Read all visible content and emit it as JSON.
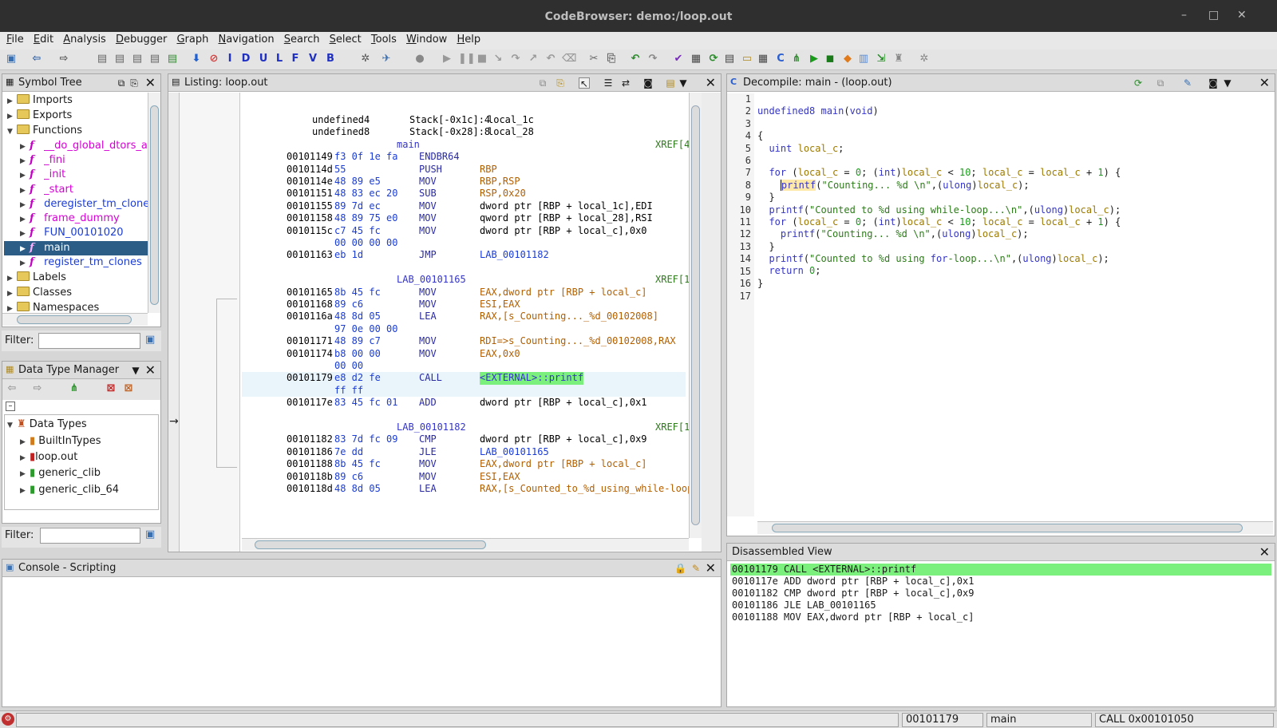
{
  "window": {
    "title": "CodeBrowser: demo:/loop.out",
    "minimize": "–",
    "maximize": "□",
    "close": "✕"
  },
  "menu": [
    "File",
    "Edit",
    "Analysis",
    "Debugger",
    "Graph",
    "Navigation",
    "Search",
    "Select",
    "Tools",
    "Window",
    "Help"
  ],
  "symbol_tree": {
    "title": "Symbol Tree",
    "roots": [
      "Imports",
      "Exports",
      "Functions"
    ],
    "functions": [
      "__do_global_dtors_a",
      "_fini",
      "_init",
      "_start",
      "deregister_tm_clone",
      "frame_dummy",
      "FUN_00101020",
      "main",
      "register_tm_clones"
    ],
    "more_roots": [
      "Labels",
      "Classes",
      "Namespaces"
    ],
    "filter_label": "Filter:"
  },
  "dtm": {
    "title": "Data Type Manager",
    "root": "Data Types",
    "items": [
      "BuiltInTypes",
      "loop.out",
      "generic_clib",
      "generic_clib_64"
    ],
    "filter_label": "Filter:"
  },
  "listing": {
    "title": "Listing:  loop.out",
    "lines": [
      {
        "kind": "stack",
        "type": "undefined4",
        "loc": "Stack[-0x1c]:4",
        "name": "local_1c"
      },
      {
        "kind": "stack",
        "type": "undefined8",
        "loc": "Stack[-0x28]:8",
        "name": "local_28"
      },
      {
        "kind": "label",
        "name": "main",
        "xref": "XREF[4"
      },
      {
        "kind": "ins",
        "addr": "00101149",
        "bytes": "f3 0f 1e fa",
        "mn": "ENDBR64",
        "op": ""
      },
      {
        "kind": "ins",
        "addr": "0010114d",
        "bytes": "55",
        "mn": "PUSH",
        "op": "RBP"
      },
      {
        "kind": "ins",
        "addr": "0010114e",
        "bytes": "48 89 e5",
        "mn": "MOV",
        "op": "RBP,RSP"
      },
      {
        "kind": "ins",
        "addr": "00101151",
        "bytes": "48 83 ec 20",
        "mn": "SUB",
        "op": "RSP,0x20"
      },
      {
        "kind": "ins",
        "addr": "00101155",
        "bytes": "89 7d ec",
        "mn": "MOV",
        "op": "dword ptr [RBP + local_1c],EDI"
      },
      {
        "kind": "ins",
        "addr": "00101158",
        "bytes": "48 89 75 e0",
        "mn": "MOV",
        "op": "qword ptr [RBP + local_28],RSI"
      },
      {
        "kind": "ins",
        "addr": "0010115c",
        "bytes": "c7 45 fc",
        "mn": "MOV",
        "op": "dword ptr [RBP + local_c],0x0"
      },
      {
        "kind": "cont",
        "bytes": "00 00 00 00"
      },
      {
        "kind": "ins",
        "addr": "00101163",
        "bytes": "eb 1d",
        "mn": "JMP",
        "op": "LAB_00101182"
      },
      {
        "kind": "label",
        "name": "LAB_00101165",
        "xref": "XREF[1"
      },
      {
        "kind": "ins",
        "addr": "00101165",
        "bytes": "8b 45 fc",
        "mn": "MOV",
        "op": "EAX,dword ptr [RBP + local_c]"
      },
      {
        "kind": "ins",
        "addr": "00101168",
        "bytes": "89 c6",
        "mn": "MOV",
        "op": "ESI,EAX"
      },
      {
        "kind": "ins",
        "addr": "0010116a",
        "bytes": "48 8d 05",
        "mn": "LEA",
        "op": "RAX,[s_Counting..._%d_00102008]"
      },
      {
        "kind": "cont",
        "bytes": "97 0e 00 00"
      },
      {
        "kind": "ins",
        "addr": "00101171",
        "bytes": "48 89 c7",
        "mn": "MOV",
        "op": "RDI=>s_Counting..._%d_00102008,RAX"
      },
      {
        "kind": "ins",
        "addr": "00101174",
        "bytes": "b8 00 00",
        "mn": "MOV",
        "op": "EAX,0x0"
      },
      {
        "kind": "cont",
        "bytes": "00 00"
      },
      {
        "kind": "ins",
        "addr": "00101179",
        "bytes": "e8 d2 fe",
        "mn": "CALL",
        "op": "<EXTERNAL>::printf",
        "hl": true
      },
      {
        "kind": "cont",
        "bytes": "ff ff"
      },
      {
        "kind": "ins",
        "addr": "0010117e",
        "bytes": "83 45 fc 01",
        "mn": "ADD",
        "op": "dword ptr [RBP + local_c],0x1"
      },
      {
        "kind": "label",
        "name": "LAB_00101182",
        "xref": "XREF[1"
      },
      {
        "kind": "ins",
        "addr": "00101182",
        "bytes": "83 7d fc 09",
        "mn": "CMP",
        "op": "dword ptr [RBP + local_c],0x9"
      },
      {
        "kind": "ins",
        "addr": "00101186",
        "bytes": "7e dd",
        "mn": "JLE",
        "op": "LAB_00101165"
      },
      {
        "kind": "ins",
        "addr": "00101188",
        "bytes": "8b 45 fc",
        "mn": "MOV",
        "op": "EAX,dword ptr [RBP + local_c]"
      },
      {
        "kind": "ins",
        "addr": "0010118b",
        "bytes": "89 c6",
        "mn": "MOV",
        "op": "ESI,EAX"
      },
      {
        "kind": "ins",
        "addr": "0010118d",
        "bytes": "48 8d 05",
        "mn": "LEA",
        "op": "RAX,[s_Counted_to_%d_using_while-loop."
      }
    ]
  },
  "decompile": {
    "title": "Decompile: main -  (loop.out)",
    "lines": [
      "",
      "undefined8 main(void)",
      "",
      "{",
      "  uint local_c;",
      "  ",
      "  for (local_c = 0; (int)local_c < 10; local_c = local_c + 1) {",
      "    printf(\"Counting... %d \\n\",(ulong)local_c);",
      "  }",
      "  printf(\"Counted to %d using while-loop...\\n\",(ulong)local_c);",
      "  for (local_c = 0; (int)local_c < 10; local_c = local_c + 1) {",
      "    printf(\"Counting... %d \\n\",(ulong)local_c);",
      "  }",
      "  printf(\"Counted to %d using for-loop...\\n\",(ulong)local_c);",
      "  return 0;",
      "}",
      ""
    ]
  },
  "console": {
    "title": "Console - Scripting"
  },
  "disassembled": {
    "title": "Disassembled View",
    "lines": [
      "00101179 CALL <EXTERNAL>::printf",
      "0010117e ADD dword ptr [RBP + local_c],0x1",
      "00101182 CMP dword ptr [RBP + local_c],0x9",
      "00101186 JLE LAB_00101165",
      "00101188 MOV EAX,dword ptr [RBP + local_c]"
    ]
  },
  "status": {
    "address": "00101179",
    "function": "main",
    "instruction": "CALL 0x00101050"
  }
}
